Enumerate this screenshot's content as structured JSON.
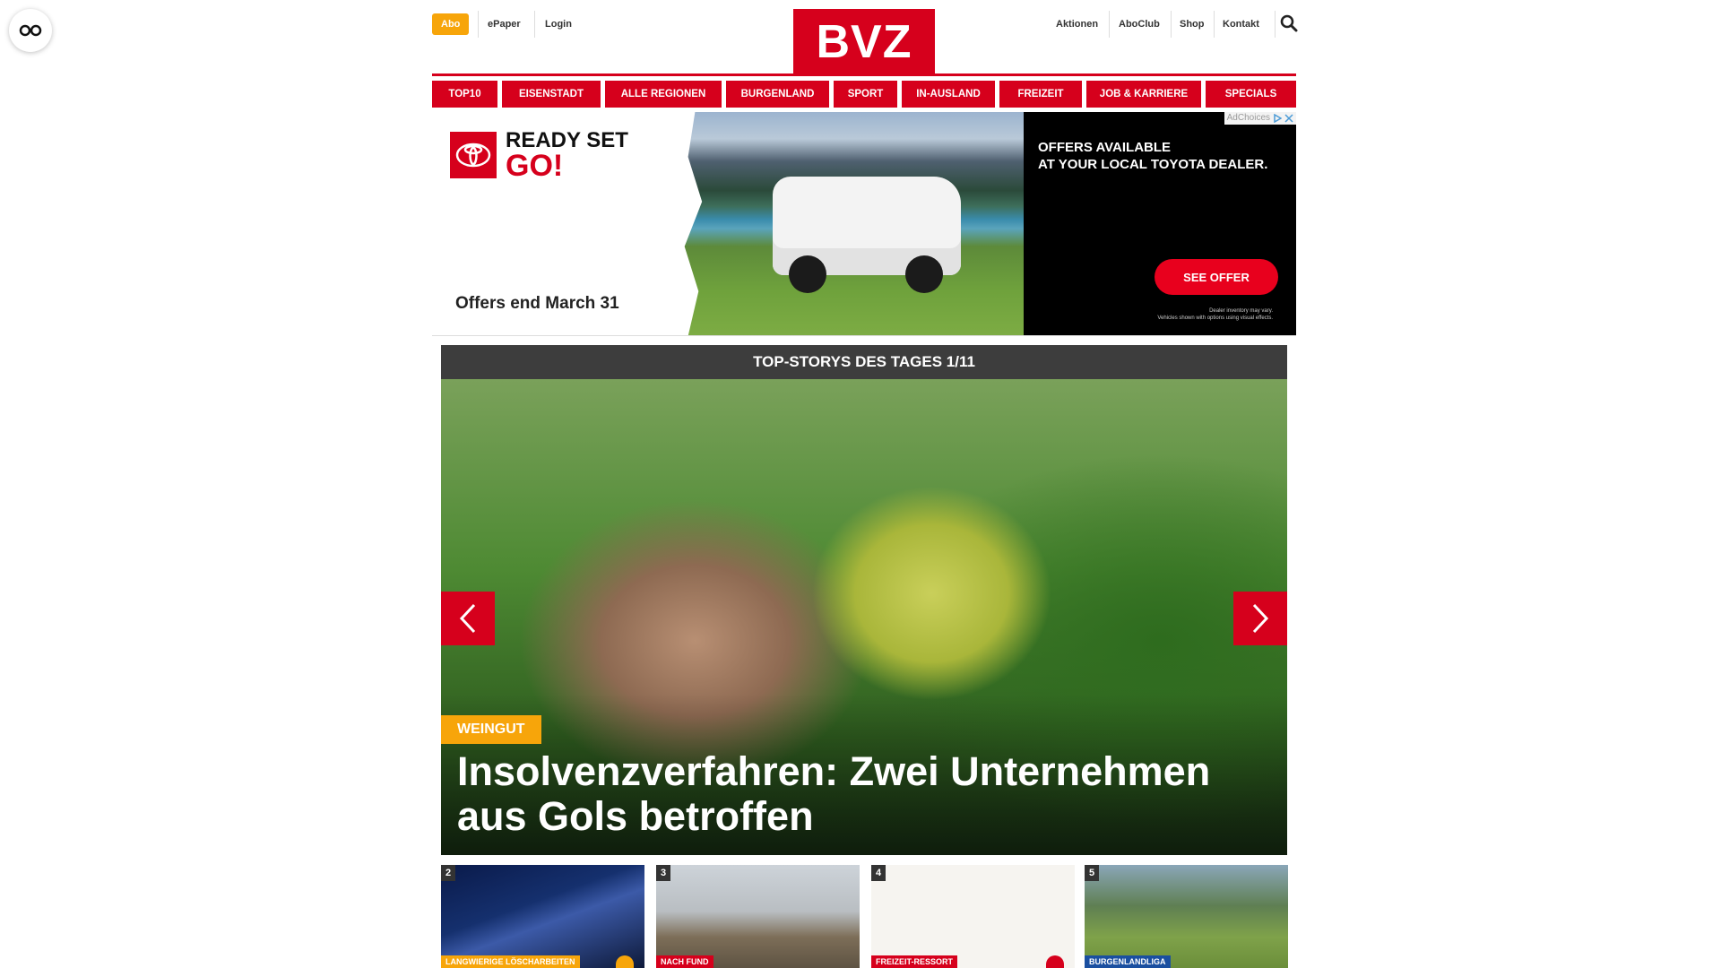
{
  "header": {
    "abo_label": "Abo",
    "epaper_label": "ePaper",
    "login_label": "Login",
    "logo_text": "BVZ",
    "aktionen_label": "Aktionen",
    "aboclub_label": "AboClub",
    "shop_label": "Shop",
    "kontakt_label": "Kontakt",
    "search_icon": "search-icon",
    "brand_color": "#d6001c",
    "accent_color": "#f7a50a"
  },
  "nav": {
    "items": [
      {
        "label": "TOP10"
      },
      {
        "label": "EISENSTADT"
      },
      {
        "label": "ALLE REGIONEN"
      },
      {
        "label": "BURGENLAND"
      },
      {
        "label": "SPORT"
      },
      {
        "label": "IN-AUSLAND"
      },
      {
        "label": "FREIZEIT"
      },
      {
        "label": "JOB & KARRIERE"
      },
      {
        "label": "SPECIALS"
      }
    ]
  },
  "ad": {
    "headline_1": "READY SET",
    "headline_2": "GO!",
    "foot": "Offers end March 31",
    "offers_line_1": "OFFERS AVAILABLE",
    "offers_line_2": "AT YOUR LOCAL TOYOTA DEALER.",
    "cta": "SEE OFFER",
    "disclaimer_1": "Dealer inventory may vary.",
    "disclaimer_2": "Vehicles shown with options using visual effects.",
    "adchoices_label": "AdChoices"
  },
  "top_stories": {
    "heading": "TOP-STORYS DES TAGES 1/11",
    "hero": {
      "tag": "WEINGUT",
      "title": "Insolvenzverfahren: Zwei Unternehmen aus Gols betroffen"
    },
    "thumbnails": [
      {
        "number": "2",
        "tag": "LANGWIERIGE LÖSCHARBEITEN",
        "tag_color": "#f7a50a",
        "has_icon": true
      },
      {
        "number": "3",
        "tag": "NACH FUND",
        "tag_color": "#d6001c",
        "has_icon": false
      },
      {
        "number": "4",
        "tag": "FREIZEIT-RESSORT",
        "tag_color": "#d6001c",
        "has_icon": true
      },
      {
        "number": "5",
        "tag": "BURGENLANDLIGA",
        "tag_color": "#1a4fa0",
        "has_icon": false
      }
    ]
  }
}
